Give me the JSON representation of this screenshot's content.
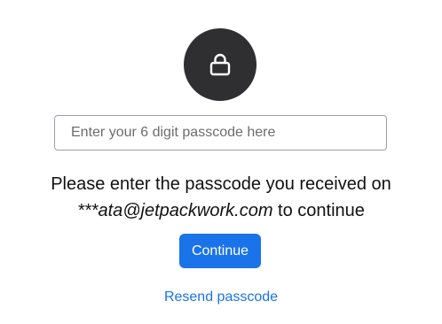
{
  "lock": {
    "icon": "lock-icon",
    "circle_color": "#2f2f31"
  },
  "passcode": {
    "placeholder": "Enter your 6 digit passcode here",
    "value": ""
  },
  "message": {
    "line1": "Please enter the passcode you received on",
    "email": "***ata@jetpackwork.com",
    "line2_suffix": " to continue"
  },
  "continue_label": "Continue",
  "resend_label": "Resend passcode",
  "colors": {
    "accent": "#1a73e8",
    "text": "#111111"
  }
}
